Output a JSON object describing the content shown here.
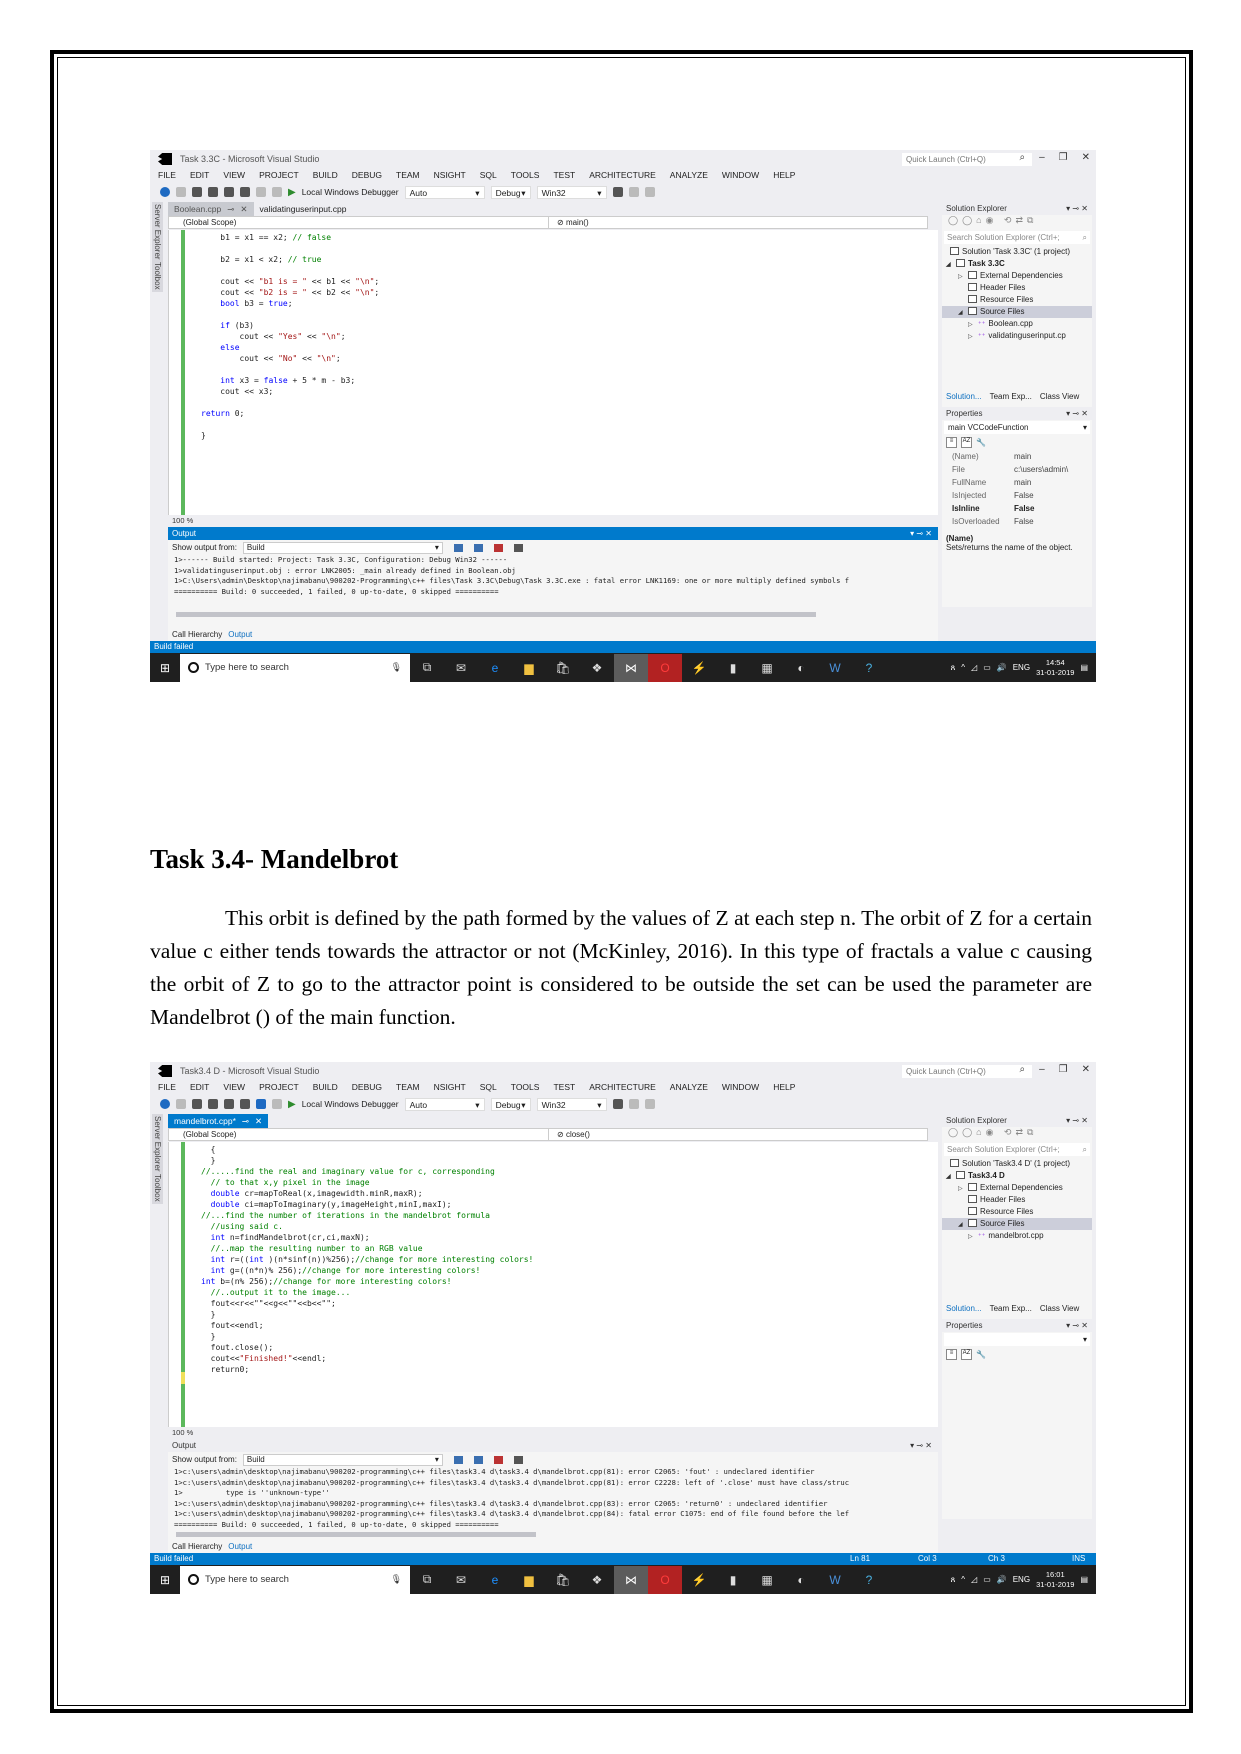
{
  "document": {
    "heading": "Task 3.4- Mandelbrot",
    "paragraph": "This orbit is defined by the path formed by the values of Z at each step n. The orbit of Z for a certain value c either tends towards the attractor or not (McKinley, 2016). In this type of fractals a value c causing the orbit of Z to go to the attractor point is considered to be outside the set can be used the parameter are Mandelbrot () of the main function."
  },
  "common": {
    "menu": [
      "FILE",
      "EDIT",
      "VIEW",
      "PROJECT",
      "BUILD",
      "DEBUG",
      "TEAM",
      "NSIGHT",
      "SQL",
      "TOOLS",
      "TEST",
      "ARCHITECTURE",
      "ANALYZE",
      "WINDOW",
      "HELP"
    ],
    "quick_launch": "Quick Launch (Ctrl+Q)",
    "debugger_label": "Local Windows Debugger",
    "auto": "Auto",
    "config": "Debug",
    "platform": "Win32",
    "side_tabs": [
      "Server Explorer",
      "Toolbox"
    ],
    "scope": "(Global Scope)",
    "zoom": "100 %",
    "output_title": "Output",
    "show_output_from": "Show output from:",
    "output_source": "Build",
    "solution_explorer": "Solution Explorer",
    "search_solution": "Search Solution Explorer (Ctrl+;",
    "external_deps": "External Dependencies",
    "header_files": "Header Files",
    "resource_files": "Resource Files",
    "source_files": "Source Files",
    "sol_tabs": [
      "Solution...",
      "Team Exp...",
      "Class View"
    ],
    "properties": "Properties",
    "bottom_tabs": [
      "Call Hierarchy",
      "Output"
    ],
    "status": "Build failed",
    "taskbar_search": "Type here to search",
    "lang": "ENG",
    "date": "31-01-2019"
  },
  "shot1": {
    "title": "Task 3.3C - Microsoft Visual Studio",
    "tabs": [
      "Boolean.cpp",
      "validatinguserinput.cpp"
    ],
    "member": "main()",
    "code": [
      [
        [
          "",
          "    b1 = x1 == x2; "
        ],
        [
          "cm",
          "// false"
        ]
      ],
      [
        [
          "",
          ""
        ]
      ],
      [
        [
          "",
          "    b2 = x1 < x2; "
        ],
        [
          "cm",
          "// true"
        ]
      ],
      [
        [
          "",
          ""
        ]
      ],
      [
        [
          "",
          "    cout << "
        ],
        [
          "st",
          "\"b1 is = \""
        ],
        [
          "",
          " << b1 << "
        ],
        [
          "st",
          "\"\\n\""
        ],
        [
          "",
          ";"
        ]
      ],
      [
        [
          "",
          "    cout << "
        ],
        [
          "st",
          "\"b2 is = \""
        ],
        [
          "",
          " << b2 << "
        ],
        [
          "st",
          "\"\\n\""
        ],
        [
          "",
          ";"
        ]
      ],
      [
        [
          "kw",
          "    bool"
        ],
        [
          "",
          " b3 = "
        ],
        [
          "kw",
          "true"
        ],
        [
          "",
          ";"
        ]
      ],
      [
        [
          "",
          ""
        ]
      ],
      [
        [
          "kw",
          "    if"
        ],
        [
          "",
          " (b3)"
        ]
      ],
      [
        [
          "",
          "        cout << "
        ],
        [
          "st",
          "\"Yes\""
        ],
        [
          "",
          " << "
        ],
        [
          "st",
          "\"\\n\""
        ],
        [
          "",
          ";"
        ]
      ],
      [
        [
          "kw",
          "    else"
        ]
      ],
      [
        [
          "",
          "        cout << "
        ],
        [
          "st",
          "\"No\""
        ],
        [
          "",
          " << "
        ],
        [
          "st",
          "\"\\n\""
        ],
        [
          "",
          ";"
        ]
      ],
      [
        [
          "",
          ""
        ]
      ],
      [
        [
          "kw",
          "    int"
        ],
        [
          "",
          " x3 = "
        ],
        [
          "kw",
          "false"
        ],
        [
          "",
          " + 5 * m - b3;"
        ]
      ],
      [
        [
          "",
          "    cout << x3;"
        ]
      ],
      [
        [
          "",
          ""
        ]
      ],
      [
        [
          "kw",
          "return"
        ],
        [
          "",
          " 0;"
        ]
      ],
      [
        [
          "",
          ""
        ]
      ],
      [
        [
          "",
          "}"
        ]
      ]
    ],
    "output": [
      "1>------ Build started: Project: Task 3.3C, Configuration: Debug Win32 ------",
      "1>validatinguserinput.obj : error LNK2005: _main already defined in Boolean.obj",
      "1>C:\\Users\\admin\\Desktop\\najimabanu\\900202-Programming\\c++ files\\Task 3.3C\\Debug\\Task 3.3C.exe : fatal error LNK1169: one or more multiply defined symbols f",
      "========== Build: 0 succeeded, 1 failed, 0 up-to-date, 0 skipped =========="
    ],
    "solution": "Solution 'Task 3.3C' (1 project)",
    "project": "Task 3.3C",
    "files": [
      "Boolean.cpp",
      "validatinguserinput.cp"
    ],
    "props_object": "main  VCCodeFunction",
    "props": [
      {
        "k": "(Name)",
        "v": "main",
        "bold": false
      },
      {
        "k": "File",
        "v": "c:\\users\\admin\\",
        "bold": false
      },
      {
        "k": "FullName",
        "v": "main",
        "bold": false
      },
      {
        "k": "IsInjected",
        "v": "False",
        "bold": false
      },
      {
        "k": "IsInline",
        "v": "False",
        "bold": true
      },
      {
        "k": "IsOverloaded",
        "v": "False",
        "bold": false
      }
    ],
    "prop_desc_title": "(Name)",
    "prop_desc": "Sets/returns the name of the object.",
    "time": "14:54"
  },
  "shot2": {
    "title": "Task3.4 D - Microsoft Visual Studio",
    "tabs": [
      "mandelbrot.cpp*"
    ],
    "member": "close()",
    "code": [
      [
        [
          "",
          "  {"
        ]
      ],
      [
        [
          "",
          "  }"
        ]
      ],
      [
        [
          "cm",
          "//.....find the real and imaginary value for c, corresponding"
        ]
      ],
      [
        [
          "cm",
          "  // to that x,y pixel in the image"
        ]
      ],
      [
        [
          "kw",
          "  double"
        ],
        [
          "",
          " cr=mapToReal(x,imagewidth.minR,maxR);"
        ]
      ],
      [
        [
          "kw",
          "  double"
        ],
        [
          "",
          " ci=mapToImaginary(y,imageHeight,minI,maxI);"
        ]
      ],
      [
        [
          "cm",
          "//...find the number of iterations in the mandelbrot formula"
        ]
      ],
      [
        [
          "cm",
          "  //using said c."
        ]
      ],
      [
        [
          "kw",
          "  int"
        ],
        [
          "",
          " n=findMandelbrot(cr,ci,maxN);"
        ]
      ],
      [
        [
          "cm",
          "  //..map the resulting number to an RGB value"
        ]
      ],
      [
        [
          "kw",
          "  int"
        ],
        [
          "",
          " r=(("
        ],
        [
          "kw",
          "int"
        ],
        [
          "",
          " )(n*sinf(n))%256);"
        ],
        [
          "cm",
          "//change for more interesting colors!"
        ]
      ],
      [
        [
          "kw",
          "  int"
        ],
        [
          "",
          " g=((n*n)% 256);"
        ],
        [
          "cm",
          "//change for more interesting colors!"
        ]
      ],
      [
        [
          "kw",
          "int"
        ],
        [
          "",
          " b=(n% 256);"
        ],
        [
          "cm",
          "//change for more interesting colors!"
        ]
      ],
      [
        [
          "cm",
          "  //..output it to the image..."
        ]
      ],
      [
        [
          "",
          "  fout<<r<<\"\"<<g<<\"\"<<b<<\"\";"
        ]
      ],
      [
        [
          "",
          "  }"
        ]
      ],
      [
        [
          "",
          "  fout<<endl;"
        ]
      ],
      [
        [
          "",
          "  }"
        ]
      ],
      [
        [
          "",
          "  fout.close();"
        ]
      ],
      [
        [
          "",
          "  cout<<"
        ],
        [
          "st",
          "\"Finished!\""
        ],
        [
          "",
          "<<endl;"
        ]
      ],
      [
        [
          "",
          "  return0;"
        ]
      ]
    ],
    "output": [
      "1>c:\\users\\admin\\desktop\\najimabanu\\900202-programming\\c++ files\\task3.4 d\\task3.4 d\\mandelbrot.cpp(81): error C2065: 'fout' : undeclared identifier",
      "1>c:\\users\\admin\\desktop\\najimabanu\\900202-programming\\c++ files\\task3.4 d\\task3.4 d\\mandelbrot.cpp(81): error C2228: left of '.close' must have class/struc",
      "1>          type is ''unknown-type''",
      "1>c:\\users\\admin\\desktop\\najimabanu\\900202-programming\\c++ files\\task3.4 d\\task3.4 d\\mandelbrot.cpp(83): error C2065: 'return0' : undeclared identifier",
      "1>c:\\users\\admin\\desktop\\najimabanu\\900202-programming\\c++ files\\task3.4 d\\task3.4 d\\mandelbrot.cpp(84): fatal error C1075: end of file found before the lef",
      "========== Build: 0 succeeded, 1 failed, 0 up-to-date, 0 skipped =========="
    ],
    "solution": "Solution 'Task3.4 D' (1 project)",
    "project": "Task3.4 D",
    "files": [
      "mandelbrot.cpp"
    ],
    "status_ln": "Ln 81",
    "status_col": "Col 3",
    "status_ch": "Ch 3",
    "status_ins": "INS",
    "time": "16:01"
  }
}
